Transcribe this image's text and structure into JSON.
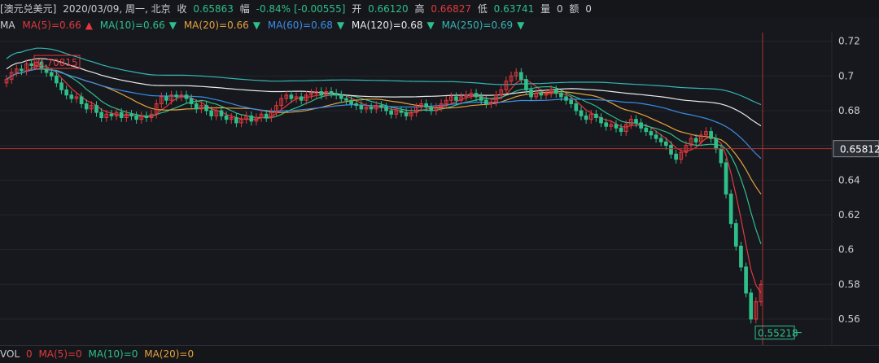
{
  "header": {
    "symbol": "[澳元兑美元]",
    "date": "2020/03/09, 周一, 北京",
    "close_label": "收",
    "close_value": "0.65863",
    "change_label": "幅",
    "change_pct": "-0.84%",
    "change_abs": "[-0.00555]",
    "open_label": "开",
    "open_value": "0.66120",
    "high_label": "高",
    "high_value": "0.66827",
    "low_label": "低",
    "low_value": "0.63741",
    "volume_label": "量",
    "volume_value": "0",
    "amount_label": "额",
    "amount_value": "0"
  },
  "ma_legend": {
    "label": "MA",
    "items": [
      {
        "text": "MA(5)=0.66",
        "color": "#e0393e",
        "arrow": "up"
      },
      {
        "text": "MA(10)=0.66",
        "color": "#2fbf8a",
        "arrow": "down"
      },
      {
        "text": "MA(20)=0.66",
        "color": "#e6a23c",
        "arrow": "down"
      },
      {
        "text": "MA(60)=0.68",
        "color": "#3b8ee8",
        "arrow": "down"
      },
      {
        "text": "MA(120)=0.68",
        "color": "#e8e8e8",
        "arrow": "down"
      },
      {
        "text": "MA(250)=0.69",
        "color": "#35b5b5",
        "arrow": "down"
      }
    ]
  },
  "volume_legend": {
    "label": "VOL",
    "vol_value": "0",
    "ma5": "MA(5)=0",
    "ma10": "MA(10)=0",
    "ma20": "MA(20)=0"
  },
  "chart_data": {
    "type": "candlestick",
    "ylim": [
      0.545,
      0.725
    ],
    "yticks": [
      "0.72",
      "0.7",
      "0.68",
      "0.66",
      "0.64",
      "0.62",
      "0.6",
      "0.58",
      "0.56"
    ],
    "crosshair_value": "0.65812",
    "max_label": "0.70815",
    "min_label": "0.55218",
    "colors": {
      "up": "#e0393e",
      "down": "#2fbf8a",
      "crosshair": "#b3302f",
      "grid": "#22252b"
    },
    "close": [
      0.698,
      0.702,
      0.704,
      0.703,
      0.707,
      0.706,
      0.708,
      0.704,
      0.702,
      0.7,
      0.696,
      0.692,
      0.689,
      0.687,
      0.688,
      0.684,
      0.681,
      0.683,
      0.679,
      0.676,
      0.678,
      0.677,
      0.679,
      0.676,
      0.678,
      0.677,
      0.675,
      0.677,
      0.676,
      0.678,
      0.684,
      0.688,
      0.686,
      0.689,
      0.688,
      0.689,
      0.687,
      0.684,
      0.681,
      0.683,
      0.68,
      0.677,
      0.68,
      0.677,
      0.675,
      0.676,
      0.673,
      0.675,
      0.677,
      0.674,
      0.676,
      0.678,
      0.676,
      0.679,
      0.683,
      0.687,
      0.689,
      0.687,
      0.688,
      0.686,
      0.689,
      0.69,
      0.691,
      0.689,
      0.691,
      0.69,
      0.689,
      0.687,
      0.686,
      0.684,
      0.683,
      0.681,
      0.682,
      0.681,
      0.683,
      0.682,
      0.68,
      0.678,
      0.68,
      0.679,
      0.677,
      0.679,
      0.682,
      0.684,
      0.682,
      0.68,
      0.682,
      0.684,
      0.686,
      0.688,
      0.686,
      0.688,
      0.689,
      0.69,
      0.688,
      0.686,
      0.684,
      0.685,
      0.689,
      0.692,
      0.697,
      0.7,
      0.702,
      0.698,
      0.692,
      0.688,
      0.69,
      0.689,
      0.69,
      0.692,
      0.69,
      0.688,
      0.686,
      0.684,
      0.68,
      0.677,
      0.675,
      0.678,
      0.676,
      0.673,
      0.671,
      0.672,
      0.67,
      0.668,
      0.672,
      0.675,
      0.673,
      0.67,
      0.668,
      0.666,
      0.664,
      0.662,
      0.66,
      0.655,
      0.652,
      0.656,
      0.66,
      0.664,
      0.662,
      0.666,
      0.668,
      0.664,
      0.658,
      0.65,
      0.632,
      0.615,
      0.602,
      0.59,
      0.575,
      0.56,
      0.57,
      0.58
    ]
  }
}
